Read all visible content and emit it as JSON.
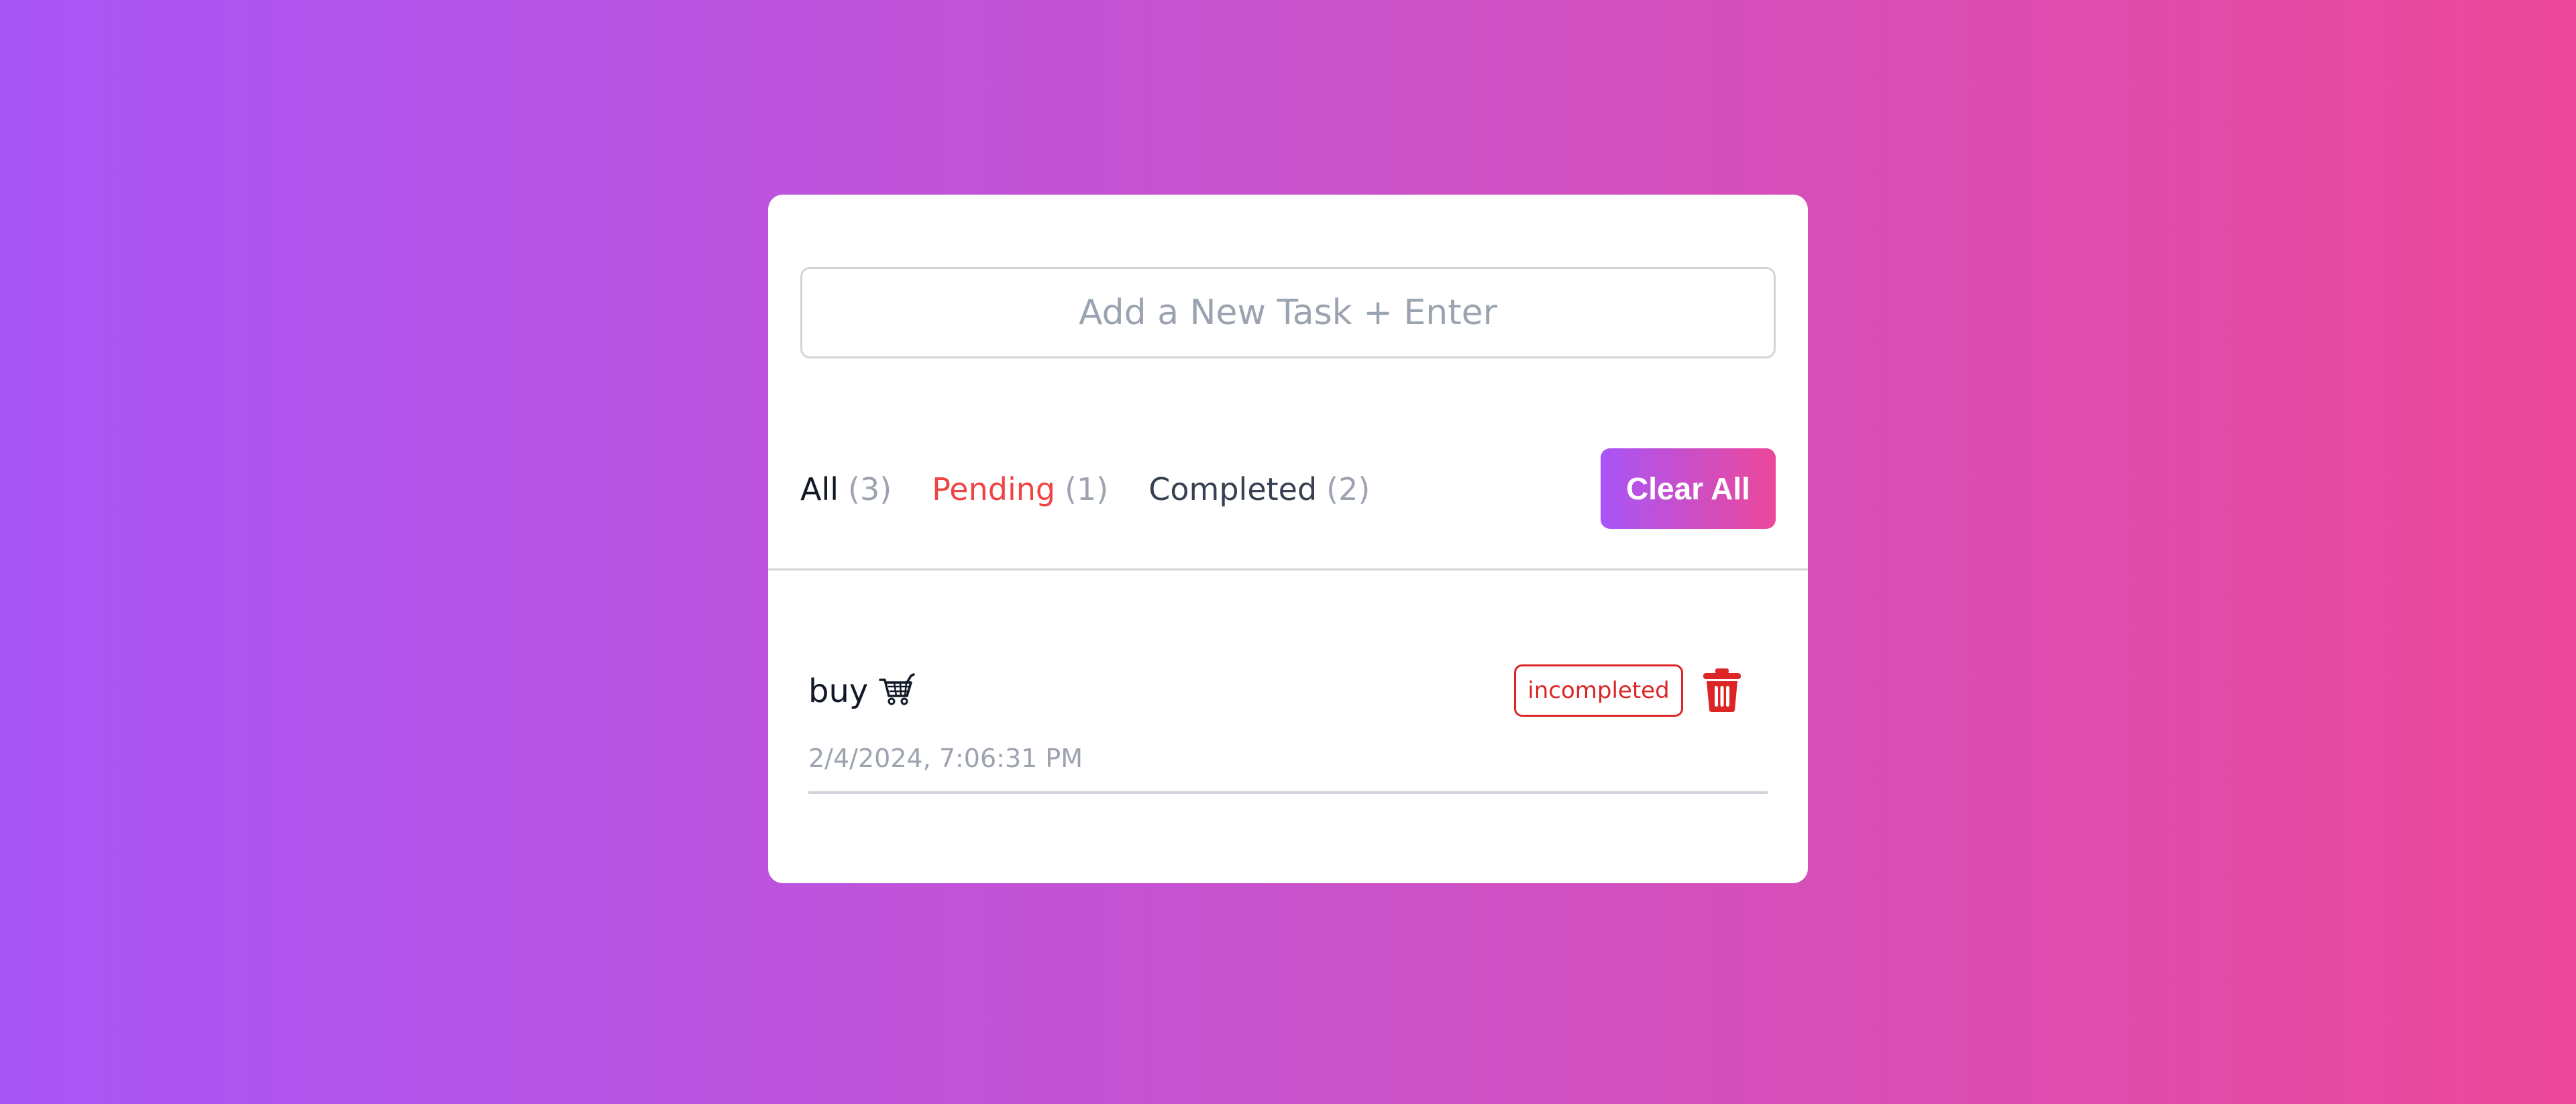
{
  "app": {
    "input": {
      "placeholder": "Add a New Task + Enter",
      "value": ""
    },
    "filters": [
      {
        "label": "All",
        "count": "(3)",
        "color": "#111827"
      },
      {
        "label": "Pending",
        "count": "(1)",
        "color": "#ef4444"
      },
      {
        "label": "Completed",
        "count": "(2)",
        "color": "#374151"
      }
    ],
    "clear_all_label": "Clear All",
    "tasks": [
      {
        "text": "buy",
        "icon": "shopping-cart-icon",
        "status": "incompleted",
        "date": "2/4/2024, 7:06:31 PM",
        "delete_icon": "trash-icon"
      }
    ]
  },
  "colors": {
    "gradient_start": "#a855f7",
    "gradient_end": "#ec4899",
    "status_red": "#dc2626",
    "muted_text": "#9ca3af"
  }
}
